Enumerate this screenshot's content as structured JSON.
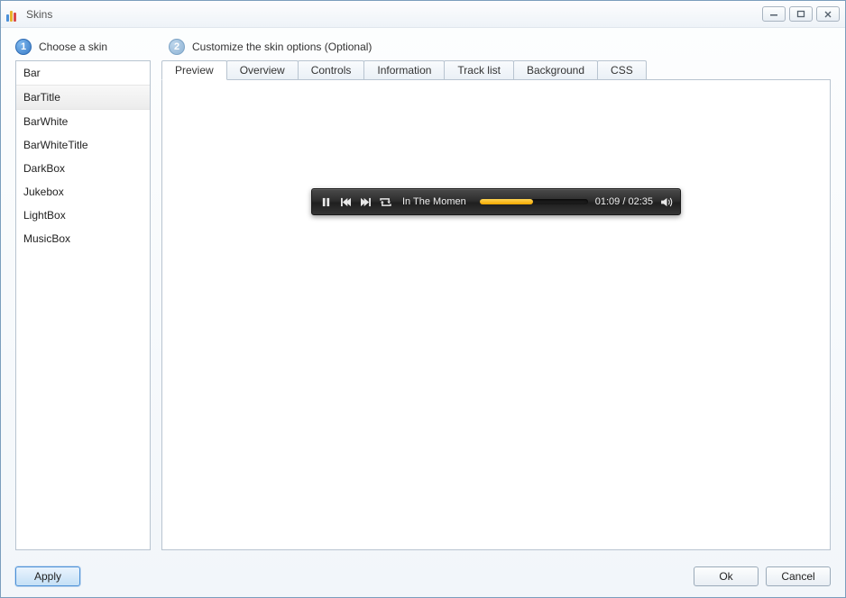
{
  "window": {
    "title": "Skins"
  },
  "steps": {
    "one": {
      "num": "1",
      "label": "Choose a skin"
    },
    "two": {
      "num": "2",
      "label": "Customize the skin options (Optional)"
    }
  },
  "skins": {
    "items": [
      "Bar",
      "BarTitle",
      "BarWhite",
      "BarWhiteTitle",
      "DarkBox",
      "Jukebox",
      "LightBox",
      "MusicBox"
    ],
    "selected_index": 1
  },
  "tabs": {
    "items": [
      "Preview",
      "Overview",
      "Controls",
      "Information",
      "Track list",
      "Background",
      "CSS"
    ],
    "active_index": 0
  },
  "player": {
    "track_title": "In The Momen",
    "time": "01:09 / 02:35",
    "progress_percent": 49
  },
  "buttons": {
    "apply": "Apply",
    "ok": "Ok",
    "cancel": "Cancel"
  }
}
